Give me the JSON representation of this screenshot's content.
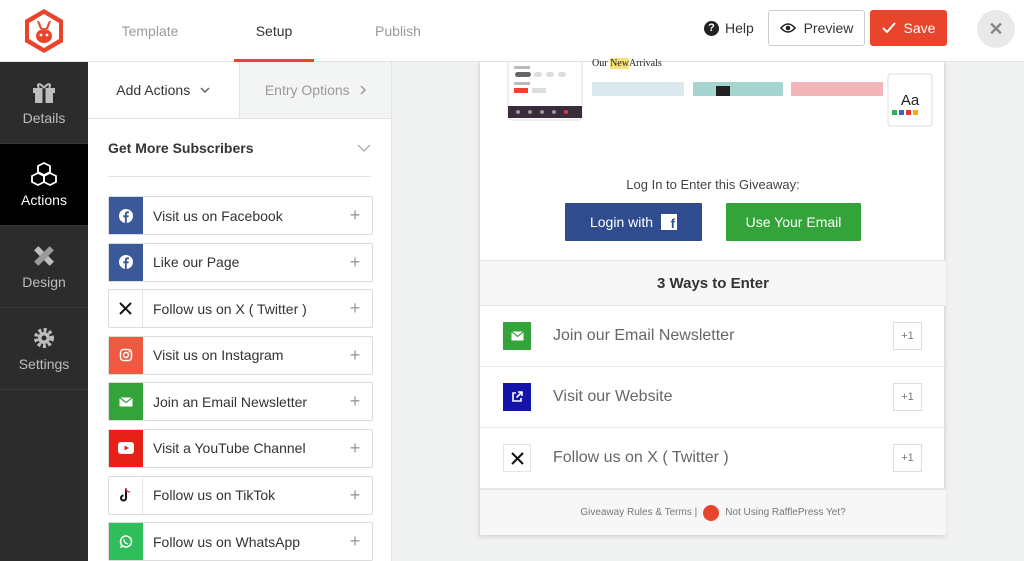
{
  "header": {
    "tabs": [
      {
        "label": "Template",
        "active": false
      },
      {
        "label": "Setup",
        "active": true
      },
      {
        "label": "Publish",
        "active": false
      }
    ],
    "help_label": "Help",
    "preview_label": "Preview",
    "save_label": "Save",
    "accent_color": "#e8452c"
  },
  "leftnav": {
    "items": [
      {
        "label": "Details",
        "icon": "gift-icon",
        "active": false
      },
      {
        "label": "Actions",
        "icon": "cubes-icon",
        "active": true
      },
      {
        "label": "Design",
        "icon": "pencil-ruler-icon",
        "active": false
      },
      {
        "label": "Settings",
        "icon": "gear-icon",
        "active": false
      }
    ]
  },
  "panel": {
    "tab_add": "Add Actions",
    "tab_entry": "Entry Options",
    "section_title": "Get More Subscribers",
    "actions": [
      {
        "label": "Visit us on Facebook",
        "icon": "facebook-icon",
        "color": "#3b5998"
      },
      {
        "label": "Like our Page",
        "icon": "facebook-icon",
        "color": "#3b5998"
      },
      {
        "label": "Follow us on X ( Twitter )",
        "icon": "x-icon",
        "color": "#ffffff"
      },
      {
        "label": "Visit us on Instagram",
        "icon": "instagram-icon",
        "color": "#ee5a3f"
      },
      {
        "label": "Join an Email Newsletter",
        "icon": "email-icon",
        "color": "#34a43a"
      },
      {
        "label": "Visit a YouTube Channel",
        "icon": "youtube-icon",
        "color": "#e62117"
      },
      {
        "label": "Follow us on TikTok",
        "icon": "tiktok-icon",
        "color": "#ffffff"
      },
      {
        "label": "Follow us on WhatsApp",
        "icon": "whatsapp-icon",
        "color": "#2fbf5a"
      }
    ]
  },
  "preview": {
    "promo_heading_prefix": "Our ",
    "promo_heading_highlight": "New",
    "promo_heading_suffix": "Arrivals",
    "promo_card_label": "Aa",
    "login_title": "Log In to Enter this Giveaway:",
    "login_facebook_label": "Login with",
    "login_email_label": "Use Your Email",
    "ways_title": "3 Ways to Enter",
    "entries": [
      {
        "label": "Join our Email Newsletter",
        "icon": "email-icon",
        "color": "#34a43a",
        "points": "+1"
      },
      {
        "label": "Visit our Website",
        "icon": "external-link-icon",
        "color": "#1414a8",
        "points": "+1"
      },
      {
        "label": "Follow us on X ( Twitter )",
        "icon": "x-icon",
        "color": "#ffffff",
        "points": "+1"
      }
    ],
    "footer_rules": "Giveaway Rules & Terms |",
    "footer_cta": "Not Using RafflePress Yet?"
  }
}
